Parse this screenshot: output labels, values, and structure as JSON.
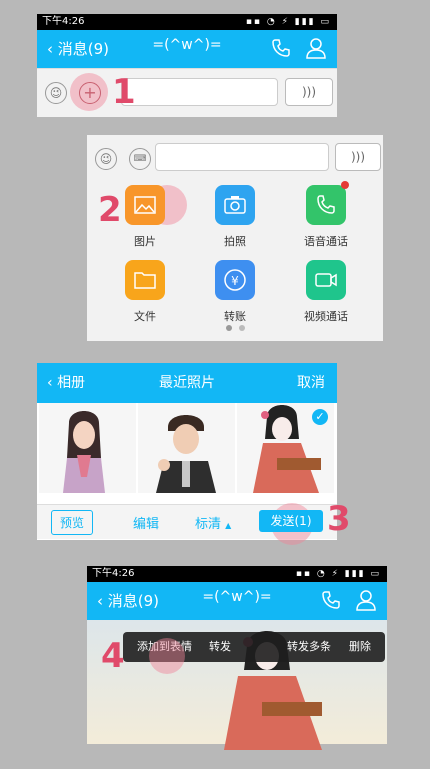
{
  "steps": [
    "1",
    "2",
    "3",
    "4"
  ],
  "status": {
    "time": "下午4:26"
  },
  "chat": {
    "back_label": "消息(9)",
    "title": "=(^w^)=",
    "emoji_glyph": "😉",
    "voice_glyph": ")))"
  },
  "more_panel": {
    "tiles": [
      {
        "label": "图片",
        "color": "#f8962a"
      },
      {
        "label": "拍照",
        "color": "#2ea4f0"
      },
      {
        "label": "语音通话",
        "color": "#33c46a"
      },
      {
        "label": "文件",
        "color": "#f8a51b"
      },
      {
        "label": "转账",
        "color": "#3e8ff0"
      },
      {
        "label": "视频通话",
        "color": "#1fc58c"
      }
    ]
  },
  "album": {
    "back_label": "相册",
    "title": "最近照片",
    "cancel_label": "取消",
    "toolbar": {
      "preview": "预览",
      "edit": "编辑",
      "quality": "标清",
      "send": "发送(1)"
    }
  },
  "context_menu": {
    "items": [
      "添加到表情",
      "转发",
      "转发多条",
      "删除"
    ]
  },
  "colors": {
    "accent": "#12b7f5",
    "step": "#e04a6a"
  }
}
